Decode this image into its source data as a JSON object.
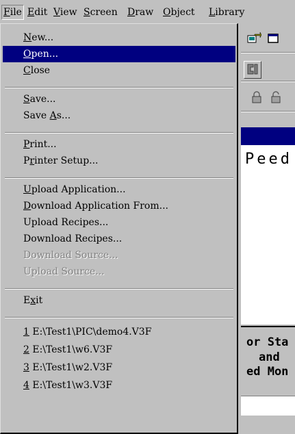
{
  "menubar": [
    {
      "id": "file",
      "pre": "",
      "key": "F",
      "post": "ile"
    },
    {
      "id": "edit",
      "pre": "",
      "key": "E",
      "post": "dit"
    },
    {
      "id": "view",
      "pre": "",
      "key": "V",
      "post": "iew"
    },
    {
      "id": "screen",
      "pre": "",
      "key": "S",
      "post": "creen"
    },
    {
      "id": "draw",
      "pre": "",
      "key": "D",
      "post": "raw"
    },
    {
      "id": "object",
      "pre": "",
      "key": "O",
      "post": "bject"
    },
    {
      "id": "library",
      "pre": "",
      "key": "L",
      "post": "ibrary"
    }
  ],
  "file_menu": {
    "new": {
      "pre": "",
      "key": "N",
      "post": "ew..."
    },
    "open": {
      "pre": "",
      "key": "O",
      "post": "pen..."
    },
    "close": {
      "pre": "",
      "key": "C",
      "post": "lose"
    },
    "save": {
      "pre": "",
      "key": "S",
      "post": "ave..."
    },
    "save_as": {
      "pre": "Save ",
      "key": "A",
      "post": "s..."
    },
    "print": {
      "pre": "",
      "key": "P",
      "post": "rint..."
    },
    "printer_setup": {
      "pre": "P",
      "key": "r",
      "post": "inter Setup..."
    },
    "upload_app": {
      "pre": "",
      "key": "U",
      "post": "pload Application..."
    },
    "download_app": {
      "pre": "",
      "key": "D",
      "post": "ownload Application From..."
    },
    "upload_recipes": {
      "pre": "Upload Recipes...",
      "key": "",
      "post": ""
    },
    "download_recipes": {
      "pre": "Download Recipes...",
      "key": "",
      "post": ""
    },
    "download_source": {
      "pre": "Download Source...",
      "key": "",
      "post": ""
    },
    "upload_source": {
      "pre": "Upload Source...",
      "key": "",
      "post": ""
    },
    "exit": {
      "pre": "E",
      "key": "x",
      "post": "it"
    },
    "recent": [
      {
        "key": "1",
        "post": " E:\\Test1\\PIC\\demo4.V3F"
      },
      {
        "key": "2",
        "post": " E:\\Test1\\w6.V3F"
      },
      {
        "key": "3",
        "post": " E:\\Test1\\w2.V3F"
      },
      {
        "key": "4",
        "post": " E:\\Test1\\w3.V3F"
      }
    ]
  },
  "background": {
    "canvas_text": "Peed",
    "status_lines": [
      "or Sta",
      "and",
      "ed Mon"
    ]
  },
  "colors": {
    "menu_bg": "#c0c0c0",
    "highlight": "#000080",
    "disabled": "#808080"
  }
}
